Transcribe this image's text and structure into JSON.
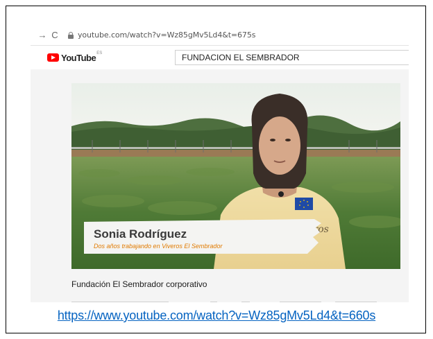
{
  "browser": {
    "url": "youtube.com/watch?v=Wz85gMv5Ld4&t=675s",
    "back_glyph": "→",
    "reload_glyph": "C"
  },
  "youtube": {
    "brand": "YouTube",
    "country_code": "ES",
    "search_value": "FUNDACION EL SEMBRADOR"
  },
  "video": {
    "speaker_name": "Sonia Rodríguez",
    "speaker_subtitle": "Dos años trabajando en Viveros El Sembrador",
    "shirt_text": "Viveros",
    "title": "Fundación El Sembrador corporativo"
  },
  "caption": {
    "link": "https://www.youtube.com/watch?v=Wz85gMv5Ld4&t=660s"
  },
  "colors": {
    "youtube_red": "#ff0000",
    "link_blue": "#0563c1",
    "subtitle_orange": "#e07a00"
  }
}
